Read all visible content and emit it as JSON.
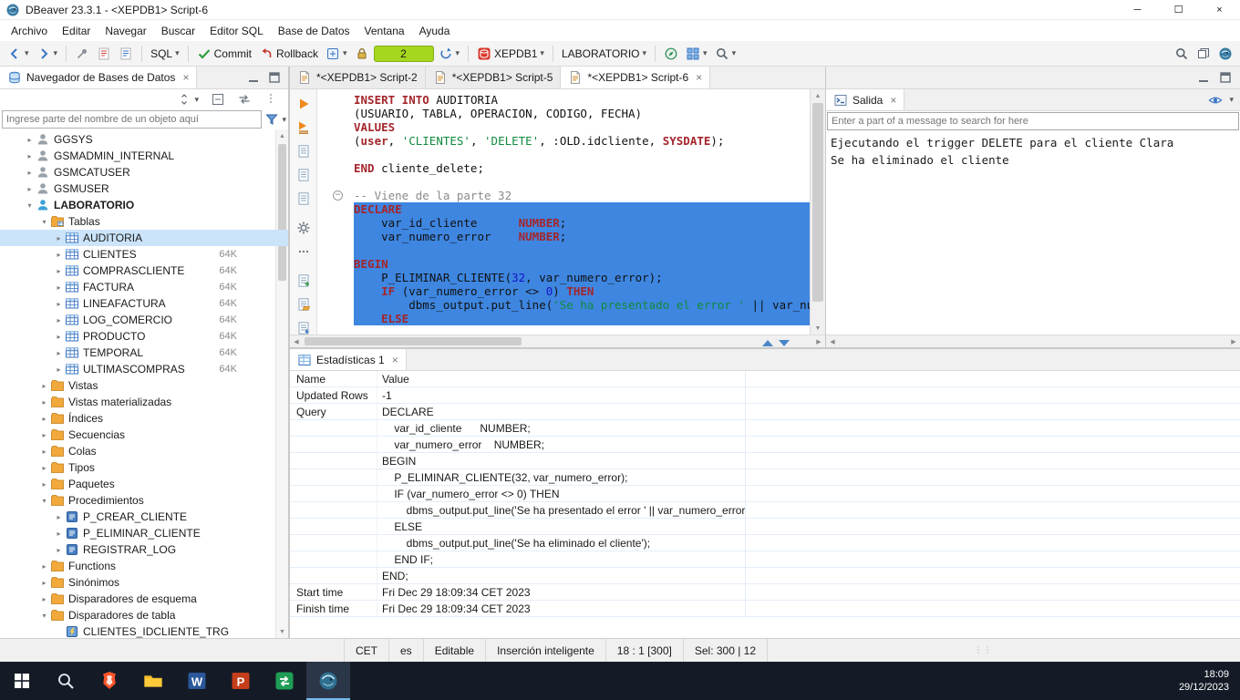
{
  "colors": {
    "selection_blue": "#3e86e0",
    "tree_selection": "#cbe4fa",
    "tx_green": "#a6d71f",
    "taskbar_bg": "#151b26",
    "keyword": "#a4262c",
    "string": "#128a3e",
    "comment": "#8a8a8a",
    "number": "#1414c8"
  },
  "titlebar": {
    "title": "DBeaver 23.3.1 - <XEPDB1> Script-6",
    "window_controls": [
      {
        "name": "minimize",
        "glyph": "─"
      },
      {
        "name": "maximize",
        "glyph": "☐"
      },
      {
        "name": "close",
        "glyph": "×"
      }
    ]
  },
  "menubar": {
    "items": [
      "Archivo",
      "Editar",
      "Navegar",
      "Buscar",
      "Editor SQL",
      "Base de Datos",
      "Ventana",
      "Ayuda"
    ]
  },
  "toolbar": {
    "groups": [
      {
        "items": [
          {
            "icon": "nav-back",
            "name": "back-history",
            "caret": true
          },
          {
            "icon": "nav-forward",
            "name": "forward-history",
            "caret": true
          }
        ]
      },
      {
        "items": [
          {
            "icon": "pin",
            "name": "pin-editor"
          },
          {
            "icon": "script-red",
            "name": "new-script-red"
          },
          {
            "icon": "script-blue",
            "name": "new-script-blue"
          }
        ]
      },
      {
        "items": [
          {
            "label": "SQL",
            "name": "sql-menu",
            "caret": true
          }
        ]
      },
      {
        "items": [
          {
            "icon": "commit-check",
            "label": "Commit",
            "name": "commit"
          },
          {
            "icon": "rollback",
            "label": "Rollback",
            "name": "rollback"
          },
          {
            "icon": "tx-mode",
            "name": "transaction-mode",
            "caret": true
          },
          {
            "icon": "lock",
            "name": "transaction-lock"
          },
          {
            "field": "2",
            "name": "transaction-count"
          },
          {
            "icon": "refresh",
            "name": "refresh-connection",
            "caret": true
          }
        ]
      },
      {
        "items": [
          {
            "icon": "db-red",
            "label": "XEPDB1",
            "name": "connection-selector",
            "caret": true
          }
        ]
      },
      {
        "items": [
          {
            "label": "LABORATORIO",
            "name": "schema-selector",
            "caret": true
          }
        ]
      },
      {
        "items": [
          {
            "icon": "compass",
            "name": "network-browser"
          },
          {
            "icon": "grid-net",
            "name": "grid-view",
            "caret": true
          },
          {
            "icon": "magnifier",
            "name": "search-metadata",
            "caret": true
          }
        ]
      }
    ],
    "right_items": [
      {
        "icon": "magnifier",
        "name": "global-search"
      },
      {
        "icon": "perspective",
        "name": "open-perspective"
      },
      {
        "icon": "dbeaver-logo",
        "name": "dbeaver-perspective"
      }
    ]
  },
  "navigator": {
    "tab_title": "Navegador de Bases de Datos",
    "filter_placeholder": "Ingrese parte del nombre de un objeto aquí",
    "tools": [
      {
        "icon": "updown",
        "name": "sort-objects",
        "caret": true
      },
      {
        "icon": "box-collapse",
        "name": "collapse-all"
      },
      {
        "icon": "link-arrows",
        "name": "link-with-editor"
      },
      {
        "icon": "grip-dots",
        "name": "panel-grip"
      }
    ],
    "tree": [
      {
        "label": "GGSYS",
        "level": 0,
        "icon": "schema",
        "expand": "closed"
      },
      {
        "label": "GSMADMIN_INTERNAL",
        "level": 0,
        "icon": "schema",
        "expand": "closed"
      },
      {
        "label": "GSMCATUSER",
        "level": 0,
        "icon": "schema",
        "expand": "closed"
      },
      {
        "label": "GSMUSER",
        "level": 0,
        "icon": "schema",
        "expand": "closed"
      },
      {
        "label": "LABORATORIO",
        "level": 0,
        "icon": "schema-active",
        "expand": "open",
        "bold": true
      },
      {
        "label": "Tablas",
        "level": 1,
        "icon": "folder-table",
        "expand": "open"
      },
      {
        "label": "AUDITORIA",
        "level": 2,
        "icon": "table",
        "expand": "closed",
        "selected": true
      },
      {
        "label": "CLIENTES",
        "level": 2,
        "icon": "table",
        "expand": "closed",
        "size": "64K"
      },
      {
        "label": "COMPRASCLIENTE",
        "level": 2,
        "icon": "table",
        "expand": "closed",
        "size": "64K"
      },
      {
        "label": "FACTURA",
        "level": 2,
        "icon": "table",
        "expand": "closed",
        "size": "64K"
      },
      {
        "label": "LINEAFACTURA",
        "level": 2,
        "icon": "table",
        "expand": "closed",
        "size": "64K"
      },
      {
        "label": "LOG_COMERCIO",
        "level": 2,
        "icon": "table",
        "expand": "closed",
        "size": "64K"
      },
      {
        "label": "PRODUCTO",
        "level": 2,
        "icon": "table",
        "expand": "closed",
        "size": "64K"
      },
      {
        "label": "TEMPORAL",
        "level": 2,
        "icon": "table",
        "expand": "closed",
        "size": "64K"
      },
      {
        "label": "ULTIMASCOMPRAS",
        "level": 2,
        "icon": "table",
        "expand": "closed",
        "size": "64K"
      },
      {
        "label": "Vistas",
        "level": 1,
        "icon": "folder",
        "expand": "closed"
      },
      {
        "label": "Vistas materializadas",
        "level": 1,
        "icon": "folder",
        "expand": "closed"
      },
      {
        "label": "Índices",
        "level": 1,
        "icon": "folder",
        "expand": "closed"
      },
      {
        "label": "Secuencias",
        "level": 1,
        "icon": "folder",
        "expand": "closed"
      },
      {
        "label": "Colas",
        "level": 1,
        "icon": "folder",
        "expand": "closed"
      },
      {
        "label": "Tipos",
        "level": 1,
        "icon": "folder",
        "expand": "closed"
      },
      {
        "label": "Paquetes",
        "level": 1,
        "icon": "folder",
        "expand": "closed"
      },
      {
        "label": "Procedimientos",
        "level": 1,
        "icon": "folder",
        "expand": "open"
      },
      {
        "label": "P_CREAR_CLIENTE",
        "level": 2,
        "icon": "proc",
        "expand": "closed"
      },
      {
        "label": "P_ELIMINAR_CLIENTE",
        "level": 2,
        "icon": "proc",
        "expand": "closed"
      },
      {
        "label": "REGISTRAR_LOG",
        "level": 2,
        "icon": "proc",
        "expand": "closed"
      },
      {
        "label": "Functions",
        "level": 1,
        "icon": "folder",
        "expand": "closed"
      },
      {
        "label": "Sinónimos",
        "level": 1,
        "icon": "folder",
        "expand": "closed"
      },
      {
        "label": "Disparadores de esquema",
        "level": 1,
        "icon": "folder",
        "expand": "closed"
      },
      {
        "label": "Disparadores de tabla",
        "level": 1,
        "icon": "folder",
        "expand": "open"
      },
      {
        "label": "CLIENTES_IDCLIENTE_TRG",
        "level": 2,
        "icon": "trigger",
        "expand": "none"
      }
    ]
  },
  "editor": {
    "tabs": [
      {
        "label": "*<XEPDB1> Script-2",
        "active": false
      },
      {
        "label": "*<XEPDB1> Script-5",
        "active": false
      },
      {
        "label": "*<XEPDB1> Script-6",
        "active": true
      }
    ],
    "strip": [
      {
        "icon": "play",
        "name": "execute-statement"
      },
      {
        "icon": "play-script",
        "name": "execute-script"
      },
      {
        "icon": "script-doc",
        "name": "explain-plan"
      },
      {
        "icon": "script-doc",
        "name": "statement-list"
      },
      {
        "icon": "script-doc",
        "name": "query-log"
      },
      {
        "gap": 40
      },
      {
        "icon": "gear",
        "name": "editor-settings"
      },
      {
        "icon": "dots-h",
        "name": "more-actions"
      },
      {
        "gap": 10
      },
      {
        "icon": "doc-new",
        "name": "new-sql-file"
      },
      {
        "icon": "doc-open",
        "name": "open-sql-file"
      },
      {
        "icon": "doc-save",
        "name": "save-sql-file"
      }
    ],
    "lines": [
      {
        "sel": false,
        "seg": [
          [
            "k",
            "INSERT INTO"
          ],
          [
            "p",
            " AUDITORIA"
          ]
        ]
      },
      {
        "sel": false,
        "seg": [
          [
            "p",
            "(USUARIO, TABLA, OPERACION, CODIGO, FECHA)"
          ]
        ]
      },
      {
        "sel": false,
        "seg": [
          [
            "k",
            "VALUES"
          ]
        ]
      },
      {
        "sel": false,
        "seg": [
          [
            "p",
            "("
          ],
          [
            "k",
            "user"
          ],
          [
            "p",
            ", "
          ],
          [
            "s",
            "'CLIENTES'"
          ],
          [
            "p",
            ", "
          ],
          [
            "s",
            "'DELETE'"
          ],
          [
            "p",
            ", :OLD.idcliente, "
          ],
          [
            "k",
            "SYSDATE"
          ],
          [
            "p",
            ");"
          ]
        ]
      },
      {
        "sel": false,
        "seg": []
      },
      {
        "sel": false,
        "seg": [
          [
            "k",
            "END"
          ],
          [
            "p",
            " cliente_delete;"
          ]
        ]
      },
      {
        "sel": false,
        "seg": []
      },
      {
        "sel": false,
        "fold": true,
        "seg": [
          [
            "c",
            "-- Viene de la parte 32"
          ]
        ]
      },
      {
        "sel": true,
        "seg": [
          [
            "k",
            "DECLARE"
          ]
        ]
      },
      {
        "sel": true,
        "seg": [
          [
            "p",
            "    var_id_cliente      "
          ],
          [
            "k",
            "NUMBER"
          ],
          [
            "p",
            ";"
          ]
        ]
      },
      {
        "sel": true,
        "seg": [
          [
            "p",
            "    var_numero_error    "
          ],
          [
            "k",
            "NUMBER"
          ],
          [
            "p",
            ";"
          ]
        ]
      },
      {
        "sel": true,
        "seg": []
      },
      {
        "sel": true,
        "seg": [
          [
            "k",
            "BEGIN"
          ]
        ]
      },
      {
        "sel": true,
        "seg": [
          [
            "p",
            "    P_ELIMINAR_CLIENTE("
          ],
          [
            "n",
            "32"
          ],
          [
            "p",
            ", var_numero_error);"
          ]
        ]
      },
      {
        "sel": true,
        "seg": [
          [
            "p",
            "    "
          ],
          [
            "k",
            "IF"
          ],
          [
            "p",
            " (var_numero_error <> "
          ],
          [
            "n",
            "0"
          ],
          [
            "p",
            ") "
          ],
          [
            "k",
            "THEN"
          ]
        ]
      },
      {
        "sel": true,
        "seg": [
          [
            "p",
            "        dbms_output.put_line("
          ],
          [
            "s",
            "'Se ha presentado el error '"
          ],
          [
            "p",
            " || var_numero"
          ]
        ]
      },
      {
        "sel": true,
        "seg": [
          [
            "p",
            "    "
          ],
          [
            "k",
            "ELSE"
          ]
        ]
      }
    ]
  },
  "output": {
    "tab_title": "Salida",
    "search_placeholder": "Enter a part of a message to search for here",
    "lines": [
      "Ejecutando el trigger DELETE para el cliente Clara",
      "Se ha eliminado el cliente"
    ]
  },
  "stats": {
    "tab_title": "Estadísticas 1",
    "columns": [
      "Name",
      "Value"
    ],
    "rows": [
      {
        "name": "Updated Rows",
        "value": "-1"
      },
      {
        "name": "Query",
        "value": "DECLARE"
      },
      {
        "name": "",
        "value": "    var_id_cliente      NUMBER;"
      },
      {
        "name": "",
        "value": "    var_numero_error    NUMBER;"
      },
      {
        "name": "",
        "value": "BEGIN"
      },
      {
        "name": "",
        "value": "    P_ELIMINAR_CLIENTE(32, var_numero_error);"
      },
      {
        "name": "",
        "value": "    IF (var_numero_error <> 0) THEN"
      },
      {
        "name": "",
        "value": "        dbms_output.put_line('Se ha presentado el error ' || var_numero_error);"
      },
      {
        "name": "",
        "value": "    ELSE"
      },
      {
        "name": "",
        "value": "        dbms_output.put_line('Se ha eliminado el cliente');"
      },
      {
        "name": "",
        "value": "    END IF;"
      },
      {
        "name": "",
        "value": "END;"
      },
      {
        "name": "Start time",
        "value": "Fri Dec 29 18:09:34 CET 2023"
      },
      {
        "name": "Finish time",
        "value": "Fri Dec 29 18:09:34 CET 2023"
      }
    ]
  },
  "statusbar": {
    "cells": [
      {
        "label": "CET",
        "name": "timezone"
      },
      {
        "label": "es",
        "name": "language"
      },
      {
        "label": "Editable",
        "name": "write-mode"
      },
      {
        "label": "Inserción inteligente",
        "name": "insert-mode"
      },
      {
        "label": "18 : 1 [300]",
        "name": "caret-position"
      },
      {
        "label": "Sel: 300 | 12",
        "name": "selection-info"
      }
    ]
  },
  "taskbar": {
    "items": [
      {
        "icon": "win-start",
        "name": "start-button"
      },
      {
        "icon": "win-search",
        "name": "taskbar-search"
      },
      {
        "icon": "brave",
        "name": "brave-browser"
      },
      {
        "icon": "explorer",
        "name": "file-explorer"
      },
      {
        "icon": "word",
        "name": "ms-word"
      },
      {
        "icon": "powerpoint",
        "name": "ms-powerpoint"
      },
      {
        "icon": "app-green",
        "name": "green-app"
      },
      {
        "icon": "dbeaver-app",
        "name": "dbeaver",
        "active": true
      }
    ],
    "clock": {
      "time": "18:09",
      "date": "29/12/2023"
    }
  }
}
